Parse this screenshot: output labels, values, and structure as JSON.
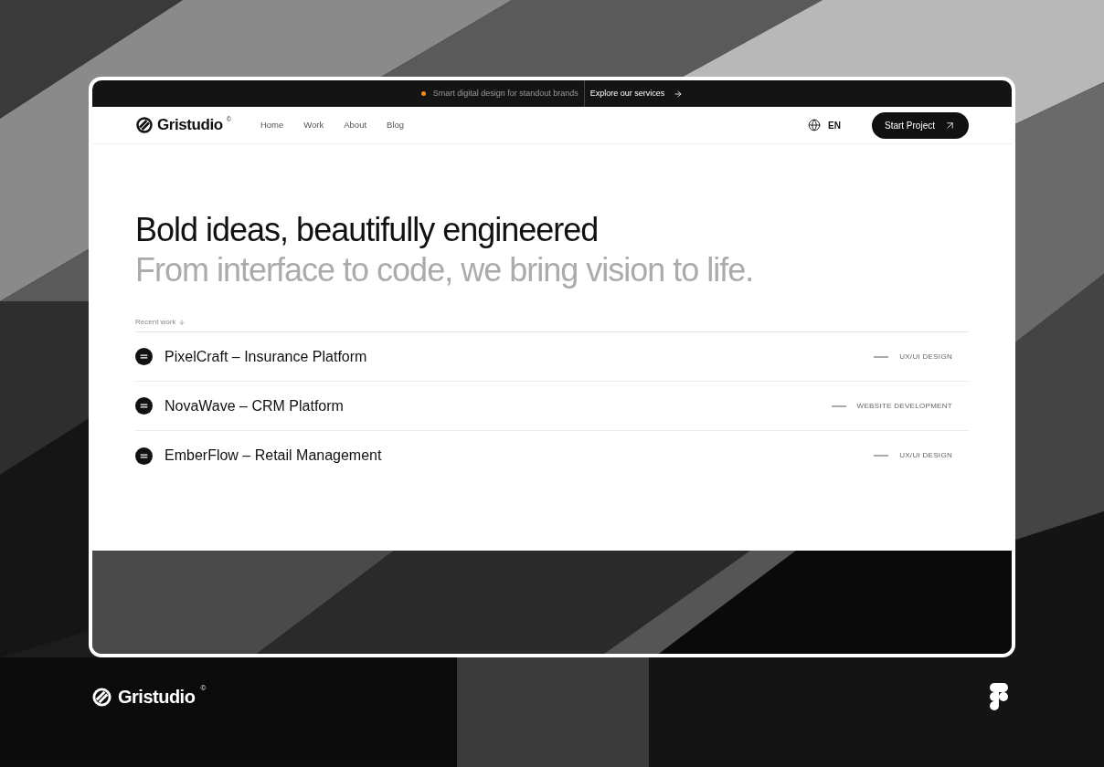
{
  "announcement": {
    "text": "Smart digital design for standout brands",
    "link": "Explore our services"
  },
  "header": {
    "logo": "Gristudio",
    "logo_mark": "©",
    "nav": [
      "Home",
      "Work",
      "About",
      "Blog"
    ],
    "language": "EN",
    "cta": "Start Project"
  },
  "hero": {
    "headline": "Bold ideas, beautifully engineered",
    "subline": "From interface to code, we bring vision to life."
  },
  "recent_work": {
    "label": "Recent work",
    "projects": [
      {
        "title": "PixelCraft – Insurance Platform",
        "tag": "UX/UI DESIGN"
      },
      {
        "title": "NovaWave – CRM Platform",
        "tag": "WEBSITE DEVELOPMENT"
      },
      {
        "title": "EmberFlow – Retail Management",
        "tag": "UX/UI DESIGN"
      }
    ]
  },
  "footer": {
    "logo": "Gristudio",
    "logo_mark": "©"
  }
}
